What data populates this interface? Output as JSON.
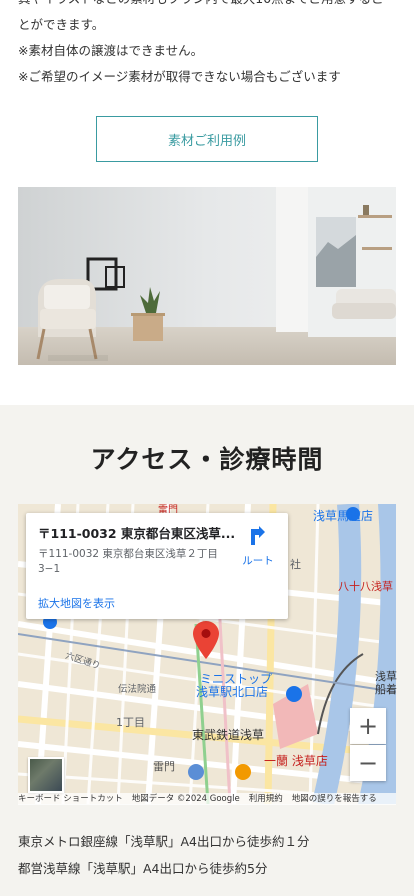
{
  "intro": {
    "line1": "真やイラストなどの素材もプラン内で最大10点までご用意するこ",
    "line2": "とができます。",
    "line3": "※素材自体の譲渡はできません。",
    "line4": "※ご希望のイメージ素材が取得できない場合もございます"
  },
  "example_button": "素材ご利用例",
  "access": {
    "title": "アクセス・診療時間"
  },
  "map": {
    "card_title": "〒111-0032 東京都台東区浅草...",
    "card_address": "〒111-0032 東京都台東区浅草２丁目3−1",
    "route_label": "ルート",
    "enlarge_link": "拡大地図を表示",
    "zoom_in": "+",
    "zoom_out": "−",
    "labels": {
      "top_left": "雷門",
      "asakusa_umamichi": "浅草馬道店",
      "shrine": "社",
      "hachijuhachi": "八十八浅草",
      "rokku": "六区通り",
      "denpoin": "伝法院通",
      "itchome": "1丁目",
      "ministop": "ミニストップ",
      "ministop2": "浅草駅北口店",
      "tobu": "東武鉄道浅草",
      "ichiran": "一蘭 浅草店",
      "kaminarimon": "雷門",
      "asakusa_right": "浅草",
      "funa": "船着"
    },
    "attribution": [
      "キーボード ショートカット",
      "地図データ ©2024 Google",
      "利用規約",
      "地図の誤りを報告する"
    ]
  },
  "transit": {
    "line1": "東京メトロ銀座線「浅草駅」A4出口から徒歩約１分",
    "line2": "都営浅草線「浅草駅」A4出口から徒歩約5分"
  },
  "colors": {
    "accent": "#3a9ba1",
    "section_bg": "#f4f3ef",
    "map_link": "#1a73e8",
    "pin": "#ea4335"
  }
}
